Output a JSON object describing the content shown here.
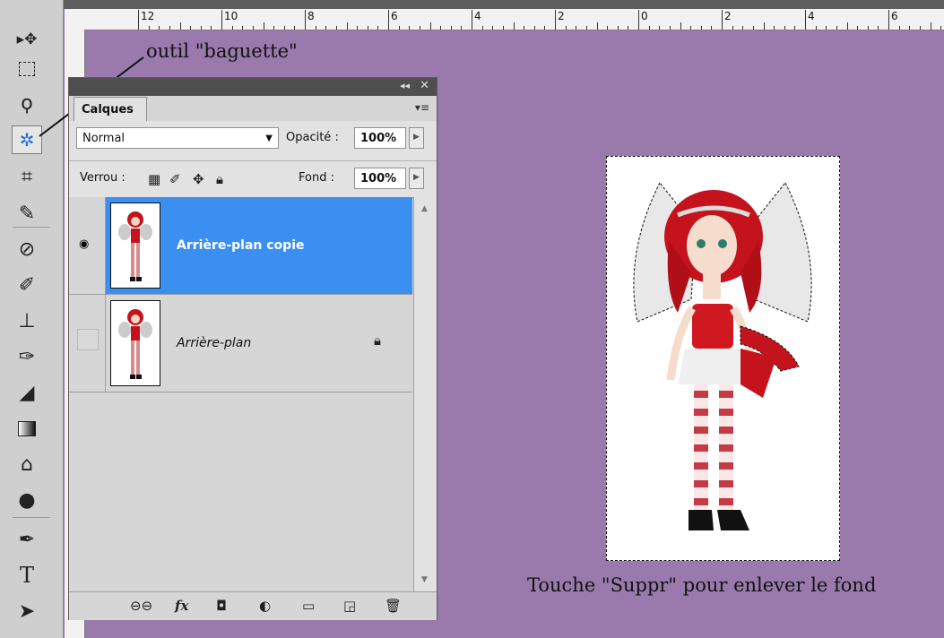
{
  "annotation": {
    "tool_label": "outil \"baguette\"",
    "caption": "Touche \"Suppr\" pour enlever le fond"
  },
  "ruler": {
    "labels": [
      "12",
      "10",
      "8",
      "6",
      "4",
      "2",
      "0",
      "2",
      "4",
      "6"
    ]
  },
  "toolbar": {
    "tools": [
      {
        "name": "move-tool",
        "icon": "move-icon"
      },
      {
        "name": "marquee-tool",
        "icon": "rectangle-marquee-icon"
      },
      {
        "name": "lasso-tool",
        "icon": "lasso-icon"
      },
      {
        "name": "magic-wand-tool",
        "icon": "magic-wand-icon",
        "selected": true
      },
      {
        "name": "crop-tool",
        "icon": "crop-icon"
      },
      {
        "name": "eyedropper-tool",
        "icon": "eyedropper-icon"
      },
      {
        "name": "healing-brush-tool",
        "icon": "bandage-icon"
      },
      {
        "name": "brush-tool",
        "icon": "brush-icon"
      },
      {
        "name": "stamp-tool",
        "icon": "stamp-icon"
      },
      {
        "name": "history-brush-tool",
        "icon": "history-brush-icon"
      },
      {
        "name": "eraser-tool",
        "icon": "eraser-icon"
      },
      {
        "name": "gradient-tool",
        "icon": "gradient-icon"
      },
      {
        "name": "blur-tool",
        "icon": "blur-drop-icon"
      },
      {
        "name": "dodge-tool",
        "icon": "dodge-icon"
      },
      {
        "name": "pen-tool",
        "icon": "pen-icon"
      },
      {
        "name": "type-tool",
        "icon": "type-icon"
      },
      {
        "name": "path-selection-tool",
        "icon": "arrow-icon"
      }
    ]
  },
  "panel": {
    "tab_label": "Calques",
    "blend_mode": "Normal",
    "opacity_label": "Opacité :",
    "opacity_value": "100%",
    "lock_label": "Verrou :",
    "fill_label": "Fond :",
    "fill_value": "100%",
    "layers": [
      {
        "name": "Arrière-plan copie",
        "visible": true,
        "selected": true
      },
      {
        "name": "Arrière-plan",
        "visible": false,
        "selected": false,
        "locked": true
      }
    ]
  },
  "colors": {
    "canvas_bg": "#9a7aad",
    "selected_layer": "#3a8ff0",
    "panel_bg": "#d6d6d6"
  }
}
